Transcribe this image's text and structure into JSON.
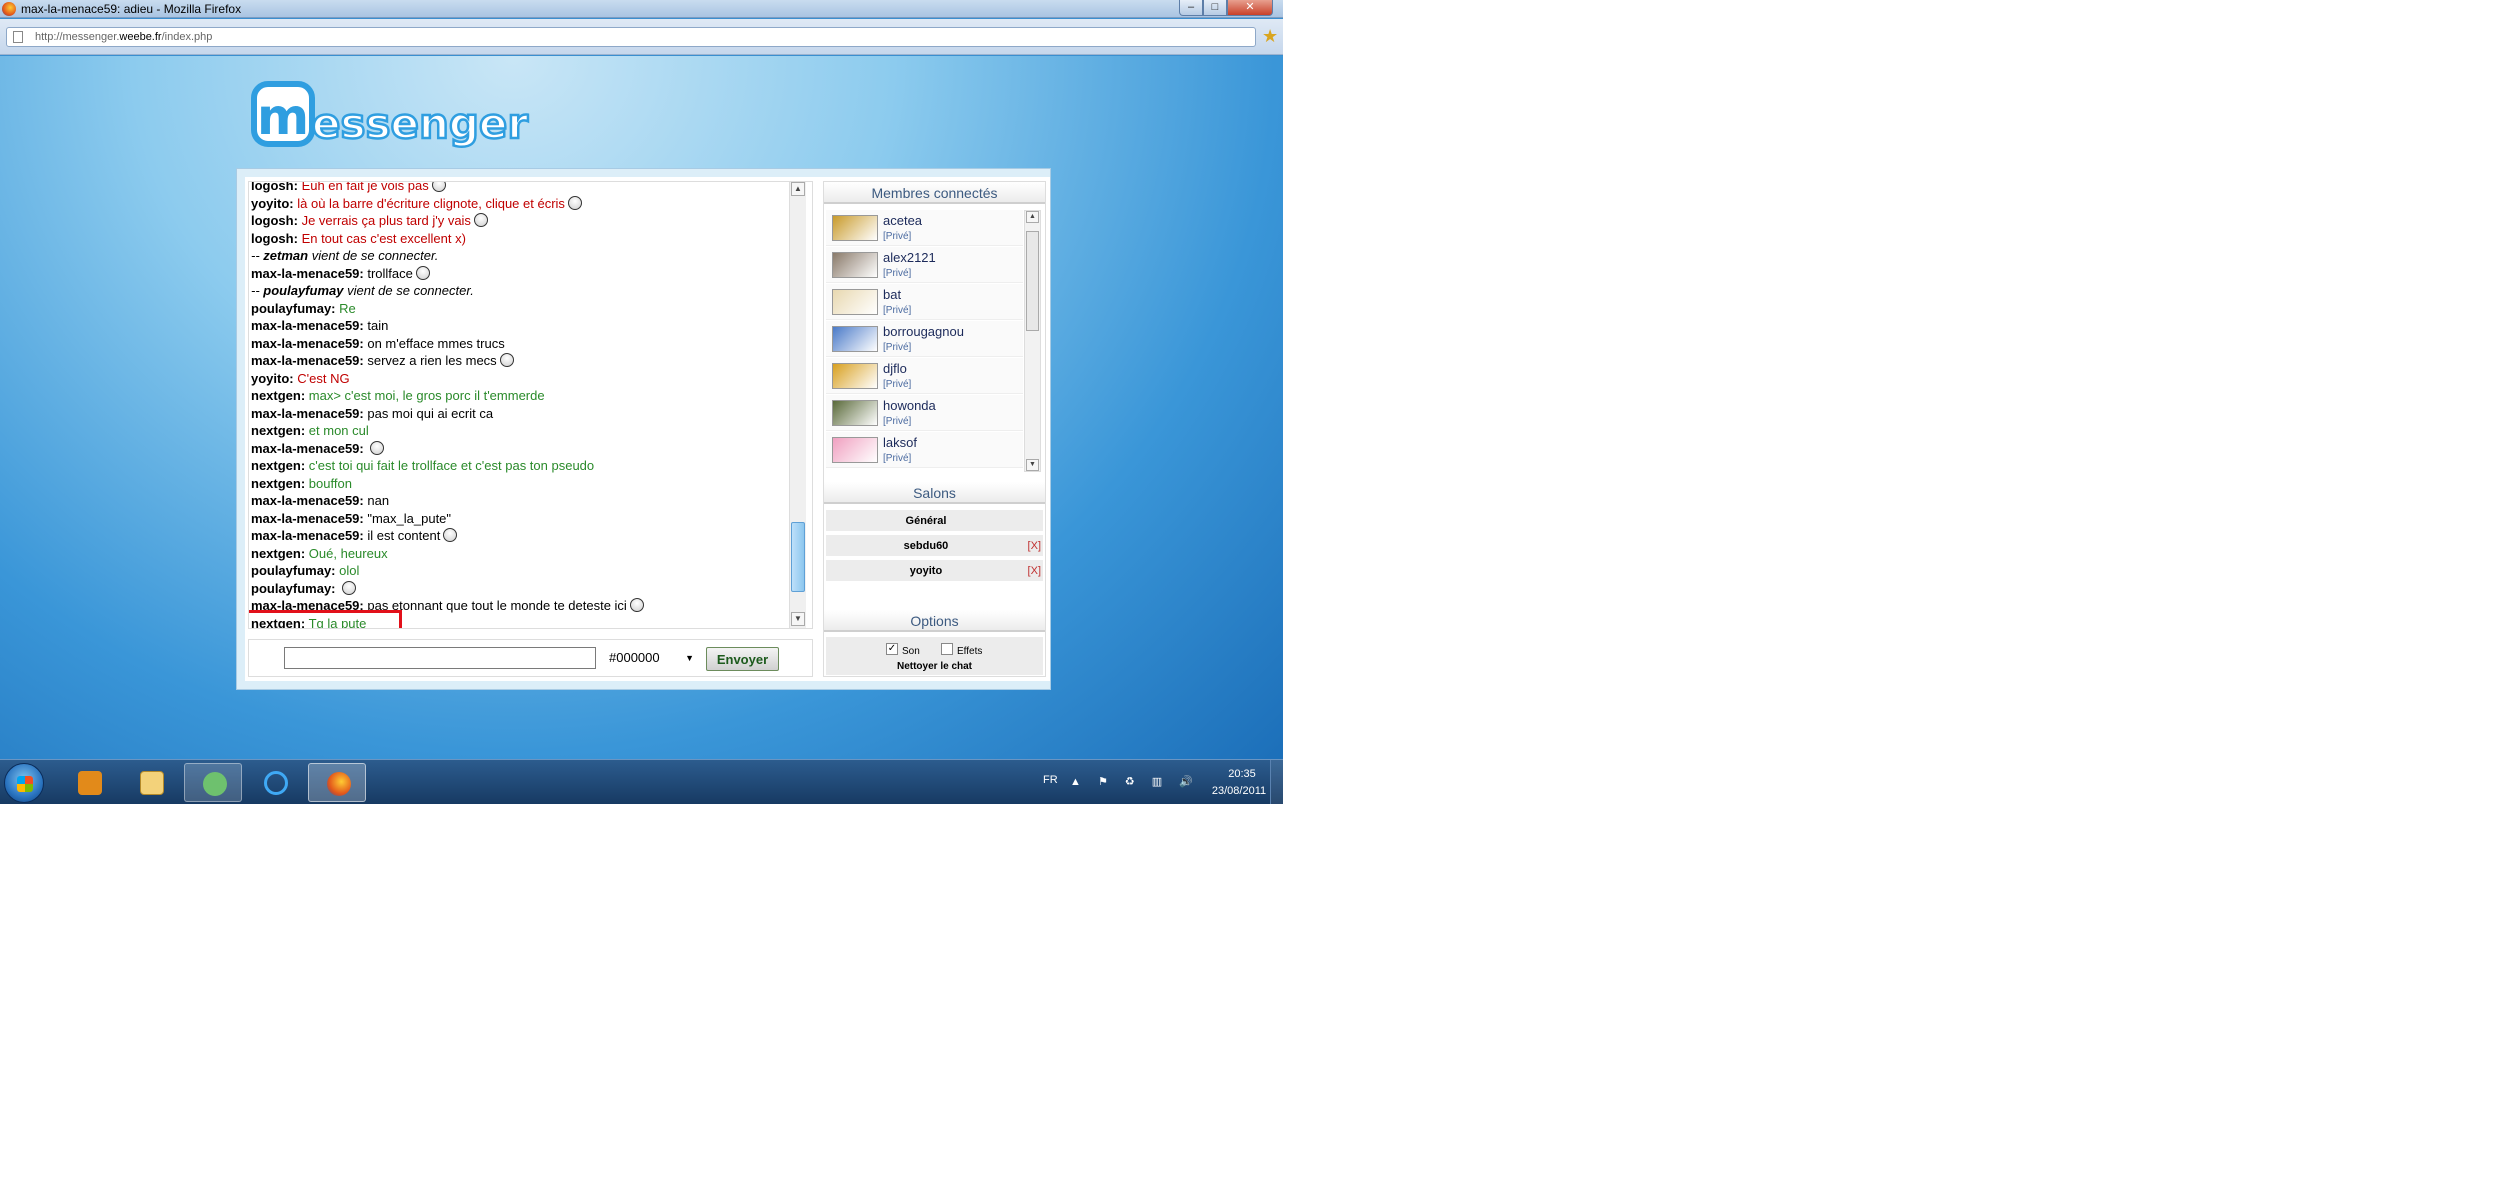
{
  "window": {
    "title": "max-la-menace59: adieu - Mozilla Firefox",
    "buttons": {
      "minimize": "–",
      "maximize": "□",
      "close": "✕"
    }
  },
  "browser": {
    "url_prefix": "http://messenger.",
    "url_domain": "weebe.fr",
    "url_path": "/index.php"
  },
  "logo_text": "essenger",
  "logo_letter": "m",
  "chat": {
    "messages": [
      {
        "nick": "logosh:",
        "text": "Euh en fait je vois pas",
        "color": "#c00000",
        "smiley": true,
        "system": false
      },
      {
        "nick": "yoyito:",
        "text": "là où la barre d'écriture clignote, clique et écris",
        "color": "#c00000",
        "smiley": true,
        "system": false
      },
      {
        "nick": "logosh:",
        "text": "Je verrais ça plus tard j'y vais",
        "color": "#c00000",
        "smiley": true,
        "system": false
      },
      {
        "nick": "logosh:",
        "text": "En tout cas c'est excellent x)",
        "color": "#c00000",
        "smiley": false,
        "system": false
      },
      {
        "nick": "zetman",
        "prefix": "-- ",
        "text": "vient de se connecter.",
        "color": "#000000",
        "smiley": false,
        "system": true
      },
      {
        "nick": "max-la-menace59:",
        "text": "trollface",
        "color": "#000000",
        "smiley": true,
        "system": false
      },
      {
        "nick": "poulayfumay",
        "prefix": "-- ",
        "text": "vient de se connecter.",
        "color": "#000000",
        "smiley": false,
        "system": true
      },
      {
        "nick": "poulayfumay:",
        "text": "Re",
        "color": "#2a8a2a",
        "smiley": false,
        "system": false
      },
      {
        "nick": "max-la-menace59:",
        "text": "tain",
        "color": "#000000",
        "smiley": false,
        "system": false
      },
      {
        "nick": "max-la-menace59:",
        "text": "on m'efface mmes trucs",
        "color": "#000000",
        "smiley": false,
        "system": false
      },
      {
        "nick": "max-la-menace59:",
        "text": "servez a rien les mecs",
        "color": "#000000",
        "smiley": true,
        "system": false
      },
      {
        "nick": "yoyito:",
        "text": "C'est NG",
        "color": "#c00000",
        "smiley": false,
        "system": false
      },
      {
        "nick": "nextgen:",
        "text": "max> c'est moi, le gros porc il t'emmerde",
        "color": "#2a8a2a",
        "smiley": false,
        "system": false
      },
      {
        "nick": "max-la-menace59:",
        "text": "pas moi qui ai ecrit ca",
        "color": "#000000",
        "smiley": false,
        "system": false
      },
      {
        "nick": "nextgen:",
        "text": "et mon cul",
        "color": "#2a8a2a",
        "smiley": false,
        "system": false
      },
      {
        "nick": "max-la-menace59:",
        "text": "",
        "color": "#000000",
        "smiley": true,
        "system": false
      },
      {
        "nick": "nextgen:",
        "text": "c'est toi qui fait le trollface et c'est pas ton pseudo",
        "color": "#2a8a2a",
        "smiley": false,
        "system": false
      },
      {
        "nick": "nextgen:",
        "text": "bouffon",
        "color": "#2a8a2a",
        "smiley": false,
        "system": false
      },
      {
        "nick": "max-la-menace59:",
        "text": "nan",
        "color": "#000000",
        "smiley": false,
        "system": false
      },
      {
        "nick": "max-la-menace59:",
        "text": "\"max_la_pute\"",
        "color": "#000000",
        "smiley": false,
        "system": false
      },
      {
        "nick": "max-la-menace59:",
        "text": "il est content",
        "color": "#000000",
        "smiley": true,
        "system": false
      },
      {
        "nick": "nextgen:",
        "text": "Oué, heureux",
        "color": "#2a8a2a",
        "smiley": false,
        "system": false
      },
      {
        "nick": "poulayfumay:",
        "text": "olol",
        "color": "#2a8a2a",
        "smiley": false,
        "system": false
      },
      {
        "nick": "poulayfumay:",
        "text": "",
        "color": "#2a8a2a",
        "smiley": true,
        "system": false
      },
      {
        "nick": "max-la-menace59:",
        "text": "pas etonnant que tout le monde te deteste ici",
        "color": "#000000",
        "smiley": true,
        "system": false
      },
      {
        "nick": "nextgen:",
        "text": "Tg la pute",
        "color": "#2a8a2a",
        "smiley": false,
        "system": false
      }
    ],
    "input_value": "",
    "color_value": "#000000",
    "send_label": "Envoyer"
  },
  "members": {
    "title": "Membres connectés",
    "private_label": "[Privé]",
    "list": [
      {
        "name": "acetea",
        "avatar_color": "#c89a2a"
      },
      {
        "name": "alex2121",
        "avatar_color": "#8a7a6a"
      },
      {
        "name": "bat",
        "avatar_color": "#e8d8b0"
      },
      {
        "name": "borrougagnou",
        "avatar_color": "#4a7ac8"
      },
      {
        "name": "djflo",
        "avatar_color": "#d8a020"
      },
      {
        "name": "howonda",
        "avatar_color": "#5a6a3a"
      },
      {
        "name": "laksof",
        "avatar_color": "#f0a0c0"
      }
    ]
  },
  "rooms": {
    "title": "Salons",
    "list": [
      {
        "name": "Général",
        "closable": false,
        "close_label": ""
      },
      {
        "name": "sebdu60",
        "closable": true,
        "close_label": "[X]"
      },
      {
        "name": "yoyito",
        "closable": true,
        "close_label": "[X]"
      }
    ]
  },
  "options": {
    "title": "Options",
    "sound_label": "Son",
    "sound_checked": true,
    "effects_label": "Effets",
    "effects_checked": false,
    "clean_label": "Nettoyer le chat"
  },
  "taskbar": {
    "language": "FR",
    "tray_icons": "▲ ⚑ ♻ ▥ 🔊",
    "time": "20:35",
    "date": "23/08/2011"
  }
}
